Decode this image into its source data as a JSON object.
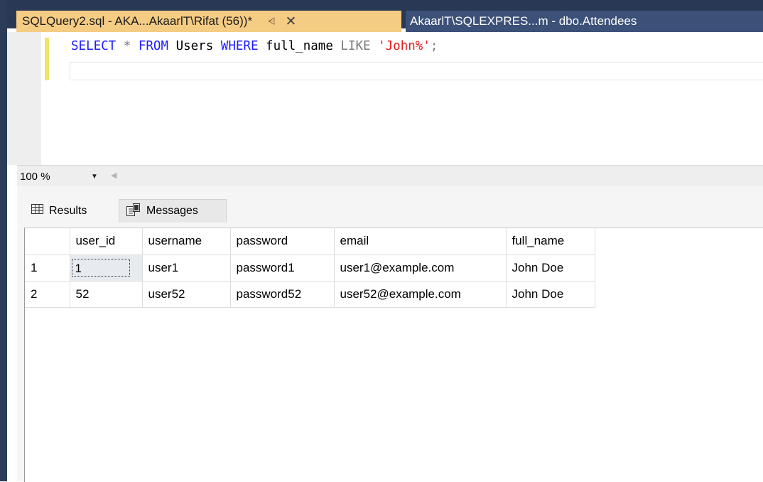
{
  "tabs": {
    "active": {
      "title": "SQLQuery2.sql - AKA...AkaarlT\\Rifat (56))*",
      "pin_icon": "pin-icon",
      "close_icon": "close-icon"
    },
    "inactive": {
      "title": "AkaarlT\\SQLEXPRES...m - dbo.Attendees"
    }
  },
  "editor": {
    "query_tokens": {
      "select": "SELECT",
      "star": "*",
      "from": "FROM",
      "table": "Users",
      "where": "WHERE",
      "column": "full_name",
      "like": "LIKE",
      "pattern": "'John%'",
      "semicolon": ";"
    }
  },
  "zoom": {
    "value": "100 %"
  },
  "results_tabs": {
    "results": "Results",
    "messages": "Messages"
  },
  "grid": {
    "columns": [
      "user_id",
      "username",
      "password",
      "email",
      "full_name"
    ],
    "rows": [
      {
        "rownum": "1",
        "user_id": "1",
        "username": "user1",
        "password": "password1",
        "email": "user1@example.com",
        "full_name": "John Doe"
      },
      {
        "rownum": "2",
        "user_id": "52",
        "username": "user52",
        "password": "password52",
        "email": "user52@example.com",
        "full_name": "John Doe"
      }
    ]
  },
  "colors": {
    "tab_active_bg": "#f5cc84",
    "tab_bar_bg": "#293955",
    "keyword": "#1c1cff",
    "string": "#e41b1b"
  }
}
